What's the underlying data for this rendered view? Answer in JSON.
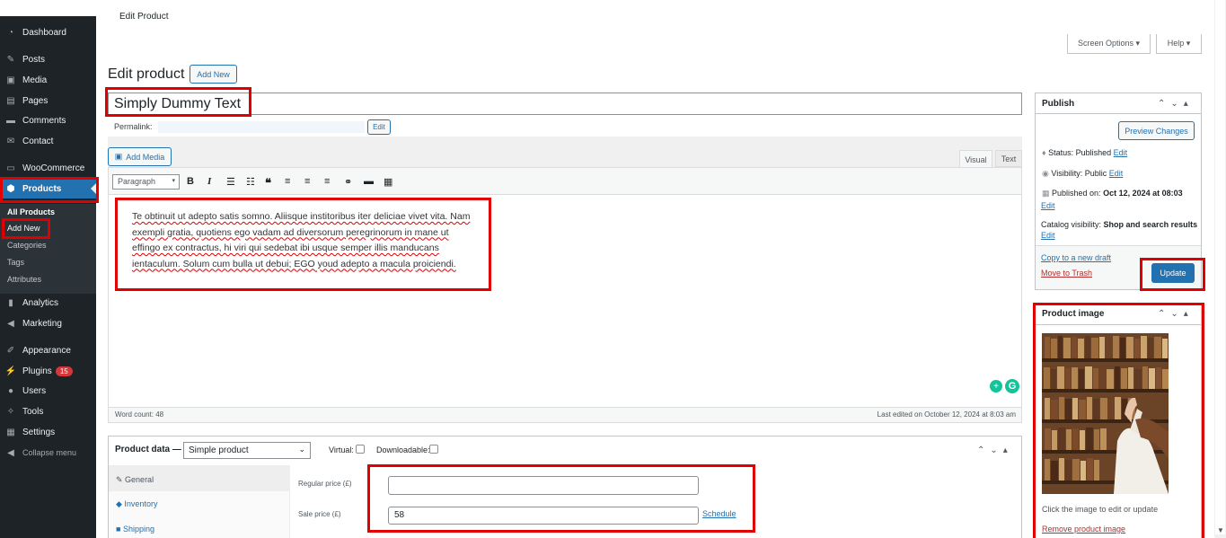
{
  "topbar": {
    "title": "Edit Product"
  },
  "sidebar": {
    "items": [
      {
        "label": "Dashboard",
        "icon": "dashboard-icon"
      },
      {
        "label": "Posts",
        "icon": "pin-icon"
      },
      {
        "label": "Media",
        "icon": "media-icon"
      },
      {
        "label": "Pages",
        "icon": "pages-icon"
      },
      {
        "label": "Comments",
        "icon": "comment-icon"
      },
      {
        "label": "Contact",
        "icon": "mail-icon"
      },
      {
        "label": "WooCommerce",
        "icon": "woocommerce-icon"
      },
      {
        "label": "Products",
        "icon": "products-icon"
      },
      {
        "label": "Analytics",
        "icon": "bar-chart-icon"
      },
      {
        "label": "Marketing",
        "icon": "megaphone-icon"
      },
      {
        "label": "Appearance",
        "icon": "brush-icon"
      },
      {
        "label": "Plugins",
        "icon": "plug-icon",
        "badge": "15"
      },
      {
        "label": "Users",
        "icon": "user-icon"
      },
      {
        "label": "Tools",
        "icon": "wrench-icon"
      },
      {
        "label": "Settings",
        "icon": "settings-icon"
      },
      {
        "label": "Collapse menu",
        "icon": "collapse-icon"
      }
    ],
    "submenu": [
      "All Products",
      "Add New",
      "Categories",
      "Tags",
      "Attributes"
    ]
  },
  "screen_options": "Screen Options ▾",
  "help": "Help ▾",
  "heading": "Edit product",
  "add_new": "Add New",
  "product_title": "Simply Dummy Text",
  "permalink_label": "Permalink:",
  "permalink_edit": "Edit",
  "add_media": "Add Media",
  "editor_tabs": {
    "visual": "Visual",
    "text": "Text"
  },
  "format_select": "Paragraph",
  "content_lines": [
    "Te obtinuit ut adepto satis somno. Aliisque institoribus iter deliciae vivet vita. Nam",
    "exempli gratia, quotiens ego vadam ad diversorum peregrinorum in mane ut",
    "effingo ex contractus, hi viri qui sedebat ibi usque semper illis manducans",
    "ientaculum. Solum cum bulla ut debui; EGO youd adepto a macula proiciendi."
  ],
  "word_count": "Word count: 48",
  "last_edited": "Last edited on October 12, 2024 at 8:03 am",
  "product_data": {
    "label": "Product data —",
    "type": "Simple product",
    "virtual": "Virtual:",
    "downloadable": "Downloadable:",
    "tabs": [
      "General",
      "Inventory",
      "Shipping"
    ],
    "regular_price_label": "Regular price (£)",
    "regular_price": "",
    "sale_price_label": "Sale price (£)",
    "sale_price": "58",
    "schedule": "Schedule"
  },
  "publish": {
    "title": "Publish",
    "preview": "Preview Changes",
    "status_label": "Status:",
    "status_value": "Published",
    "visibility_label": "Visibility:",
    "visibility_value": "Public",
    "published_label": "Published on:",
    "published_value": "Oct 12, 2024 at 08:03",
    "edit": "Edit",
    "catalog_label": "Catalog visibility:",
    "catalog_value": "Shop and search results",
    "copy_draft": "Copy to a new draft",
    "trash": "Move to Trash",
    "update": "Update"
  },
  "product_image": {
    "title": "Product image",
    "hint": "Click the image to edit or update",
    "remove": "Remove product image"
  }
}
